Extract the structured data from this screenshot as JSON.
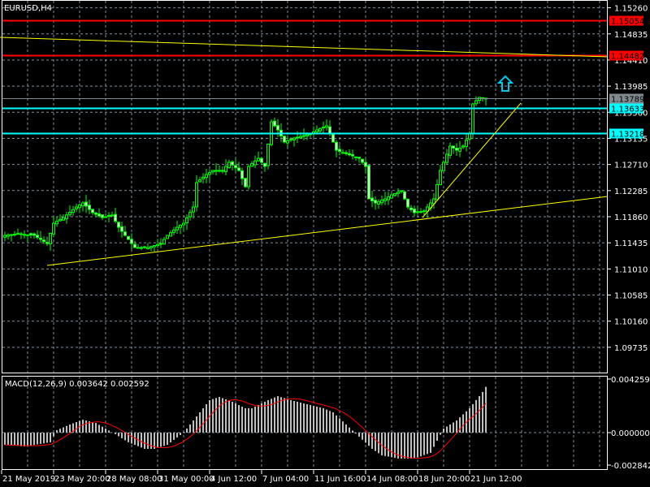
{
  "window": {
    "title": "EURUSD,H4"
  },
  "colors": {
    "bull": "#00ff00",
    "grid": "#8090a0",
    "support": "#00ffff",
    "resistance": "#ff0000",
    "trend": "#ffff00",
    "bid": "#808890",
    "macd_hist": "#c0c0c0",
    "macd_signal": "#ff0000"
  },
  "price_axis": {
    "ticks": [
      "1.15260",
      "1.14835",
      "1.14410",
      "1.13985",
      "1.13560",
      "1.13135",
      "1.12710",
      "1.12285",
      "1.11860",
      "1.11435",
      "1.11010",
      "1.10585",
      "1.10160",
      "1.09735"
    ],
    "tick_values": [
      1.1526,
      1.14835,
      1.1441,
      1.13985,
      1.1356,
      1.13135,
      1.1271,
      1.12285,
      1.1186,
      1.11435,
      1.1101,
      1.10585,
      1.1016,
      1.09735
    ]
  },
  "levels": [
    {
      "label": "1.15054",
      "value": 1.15054,
      "color": "#ff0000",
      "text_color": "#000000"
    },
    {
      "label": "1.14482",
      "value": 1.14482,
      "color": "#ff0000",
      "text_color": "#000000"
    },
    {
      "label": "1.13633",
      "value": 1.13633,
      "color": "#00ffff",
      "text_color": "#000000"
    },
    {
      "label": "1.13218",
      "value": 1.13218,
      "color": "#00ffff",
      "text_color": "#000000"
    },
    {
      "label": "1.13789",
      "value": 1.13789,
      "color": "#808890",
      "text_color": "#000000"
    }
  ],
  "close_keypoints": [
    [
      0,
      1.11556
    ],
    [
      4,
      1.11582
    ],
    [
      9,
      1.11556
    ],
    [
      13,
      1.11424
    ],
    [
      15,
      1.11754
    ],
    [
      18,
      1.11846
    ],
    [
      22,
      1.12018
    ],
    [
      24,
      1.12084
    ],
    [
      27,
      1.11926
    ],
    [
      30,
      1.11846
    ],
    [
      33,
      1.11886
    ],
    [
      35,
      1.11688
    ],
    [
      38,
      1.1149
    ],
    [
      40,
      1.11358
    ],
    [
      44,
      1.11358
    ],
    [
      48,
      1.11424
    ],
    [
      50,
      1.11556
    ],
    [
      53,
      1.11688
    ],
    [
      55,
      1.11754
    ],
    [
      58,
      1.12018
    ],
    [
      59,
      1.12415
    ],
    [
      62,
      1.12547
    ],
    [
      64,
      1.12613
    ],
    [
      67,
      1.12613
    ],
    [
      69,
      1.12745
    ],
    [
      72,
      1.12613
    ],
    [
      74,
      1.12349
    ],
    [
      75,
      1.12679
    ],
    [
      78,
      1.12811
    ],
    [
      80,
      1.12679
    ],
    [
      82,
      1.13405
    ],
    [
      84,
      1.13273
    ],
    [
      86,
      1.13075
    ],
    [
      89,
      1.13141
    ],
    [
      91,
      1.13167
    ],
    [
      94,
      1.13207
    ],
    [
      96,
      1.13273
    ],
    [
      99,
      1.13339
    ],
    [
      100,
      1.13207
    ],
    [
      102,
      1.12943
    ],
    [
      104,
      1.12903
    ],
    [
      107,
      1.1285
    ],
    [
      109,
      1.12811
    ],
    [
      111,
      1.12679
    ],
    [
      112,
      1.1215
    ],
    [
      114,
      1.12084
    ],
    [
      117,
      1.1215
    ],
    [
      119,
      1.12216
    ],
    [
      122,
      1.12282
    ],
    [
      124,
      1.12018
    ],
    [
      126,
      1.11926
    ],
    [
      129,
      1.11952
    ],
    [
      132,
      1.1215
    ],
    [
      134,
      1.12613
    ],
    [
      137,
      1.13009
    ],
    [
      139,
      1.12943
    ],
    [
      141,
      1.13009
    ],
    [
      143,
      1.13207
    ],
    [
      144,
      1.13696
    ],
    [
      146,
      1.13801
    ],
    [
      148,
      1.13789
    ]
  ],
  "macd": {
    "label": "MACD(12,26,9) 0.003642 0.002592",
    "axis_ticks": [
      "0.004259",
      "0.000000",
      "-0.002842"
    ],
    "axis_values": [
      0.004259,
      0,
      -0.002842
    ],
    "hist_keypoints": [
      [
        0,
        -0.00097
      ],
      [
        6,
        -0.0011
      ],
      [
        14,
        -0.00077
      ],
      [
        16,
        0.00019
      ],
      [
        20,
        0.00065
      ],
      [
        24,
        0.00103
      ],
      [
        28,
        0.00077
      ],
      [
        31,
        0.00032
      ],
      [
        34,
        -0.00013
      ],
      [
        38,
        -0.00077
      ],
      [
        43,
        -0.00129
      ],
      [
        46,
        -0.00129
      ],
      [
        50,
        -0.00097
      ],
      [
        54,
        -0.00019
      ],
      [
        56,
        0.00032
      ],
      [
        59,
        0.00129
      ],
      [
        63,
        0.00258
      ],
      [
        66,
        0.00284
      ],
      [
        70,
        0.00245
      ],
      [
        74,
        0.00194
      ],
      [
        76,
        0.00194
      ],
      [
        81,
        0.00258
      ],
      [
        84,
        0.0029
      ],
      [
        88,
        0.00258
      ],
      [
        93,
        0.00226
      ],
      [
        98,
        0.00194
      ],
      [
        101,
        0.00161
      ],
      [
        105,
        0.00065
      ],
      [
        109,
        -0.00032
      ],
      [
        113,
        -0.00129
      ],
      [
        116,
        -0.00181
      ],
      [
        121,
        -0.00206
      ],
      [
        126,
        -0.00206
      ],
      [
        131,
        -0.00161
      ],
      [
        135,
        0.00032
      ],
      [
        139,
        0.00097
      ],
      [
        143,
        0.00194
      ],
      [
        147,
        0.00323
      ],
      [
        148,
        0.00364
      ]
    ]
  },
  "time_axis": [
    "21 May 2019",
    "23 May 20:00",
    "28 May 08:00",
    "31 May 00:00",
    "4 Jun 12:00",
    "7 Jun 04:00",
    "11 Jun 16:00",
    "14 Jun 08:00",
    "18 Jun 20:00",
    "21 Jun 12:00"
  ]
}
